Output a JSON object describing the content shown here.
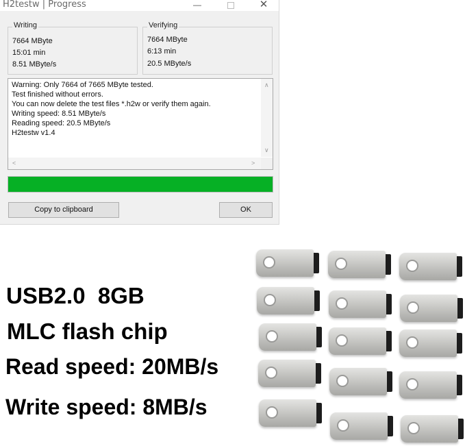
{
  "window": {
    "title": "H2testw | Progress",
    "minimize_glyph": "—",
    "close_glyph": "✕"
  },
  "writing": {
    "label": "Writing",
    "size": "7664 MByte",
    "time": "15:01 min",
    "speed": "8.51 MByte/s"
  },
  "verifying": {
    "label": "Verifying",
    "size": "7664 MByte",
    "time": "6:13 min",
    "speed": "20.5 MByte/s"
  },
  "log": {
    "lines": [
      "Warning: Only 7664 of 7665 MByte tested.",
      "Test finished without errors.",
      "You can now delete the test files *.h2w or verify them again.",
      "Writing speed: 8.51 MByte/s",
      "Reading speed: 20.5 MByte/s",
      "H2testw v1.4"
    ],
    "arrow_up": "∧",
    "arrow_down": "∨",
    "arrow_left": "<",
    "arrow_right": ">"
  },
  "progress": {
    "fraction": 1.0,
    "color": "#06b025"
  },
  "buttons": {
    "copy": "Copy to clipboard",
    "ok": "OK"
  },
  "specs": {
    "line1": "USB2.0  8GB",
    "line2": "MLC flash chip",
    "line3": "Read speed: 20MB/s",
    "line4": "Write speed: 8MB/s"
  },
  "product": {
    "drive_count": 15,
    "drive_color": "#c8c8c6",
    "plug_color": "#1d1d1d"
  }
}
